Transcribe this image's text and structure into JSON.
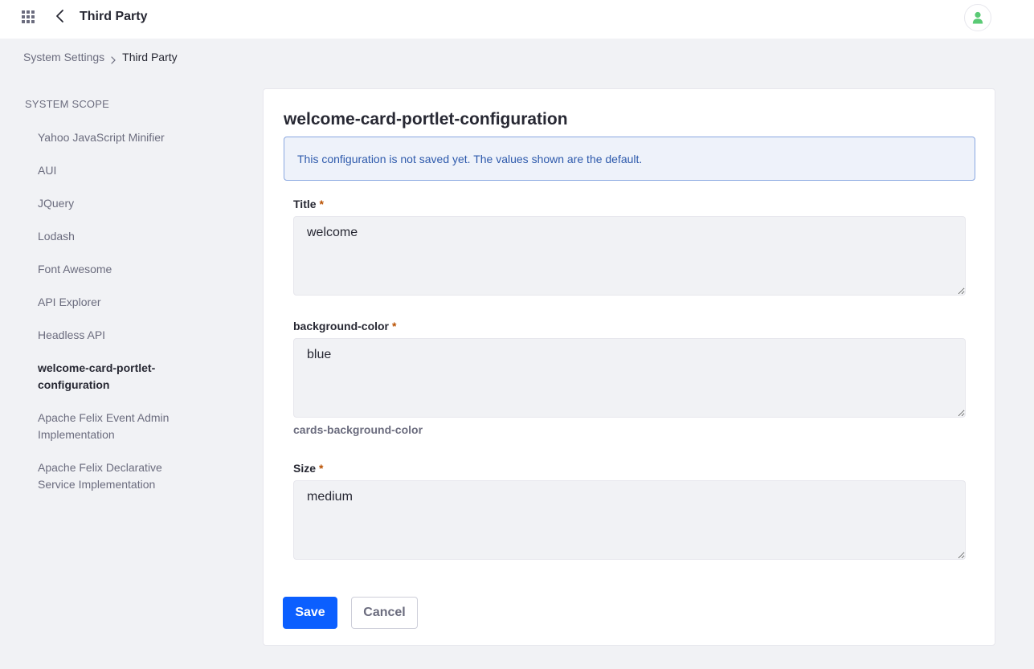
{
  "header": {
    "title": "Third Party"
  },
  "breadcrumb": {
    "items": [
      "System Settings",
      "Third Party"
    ]
  },
  "sidebar": {
    "heading": "SYSTEM SCOPE",
    "items": [
      {
        "label": "Yahoo JavaScript Minifier",
        "active": false
      },
      {
        "label": "AUI",
        "active": false
      },
      {
        "label": "JQuery",
        "active": false
      },
      {
        "label": "Lodash",
        "active": false
      },
      {
        "label": "Font Awesome",
        "active": false
      },
      {
        "label": "API Explorer",
        "active": false
      },
      {
        "label": "Headless API",
        "active": false
      },
      {
        "label": "welcome-card-portlet-configuration",
        "active": true
      },
      {
        "label": "Apache Felix Event Admin Implementation",
        "active": false
      },
      {
        "label": "Apache Felix Declarative Service Implementation",
        "active": false
      }
    ]
  },
  "main": {
    "title": "welcome-card-portlet-configuration",
    "alert": "This configuration is not saved yet. The values shown are the default.",
    "fields": [
      {
        "label": "Title",
        "required_mark": "*",
        "value": "welcome",
        "help": ""
      },
      {
        "label": "background-color",
        "required_mark": "*",
        "value": "blue",
        "help": "cards-background-color"
      },
      {
        "label": "Size",
        "required_mark": "*",
        "value": "medium",
        "help": ""
      }
    ],
    "save_label": "Save",
    "cancel_label": "Cancel"
  },
  "colors": {
    "primary": "#0b5fff",
    "alert_bg": "#eef2fa",
    "alert_text": "#2e5aac",
    "required": "#b95000",
    "avatar": "#5aca75"
  },
  "icons": {
    "apps": "grid-icon",
    "back": "chevron-left-icon",
    "avatar": "user-icon",
    "breadcrumb_separator": "chevron-right-icon"
  }
}
